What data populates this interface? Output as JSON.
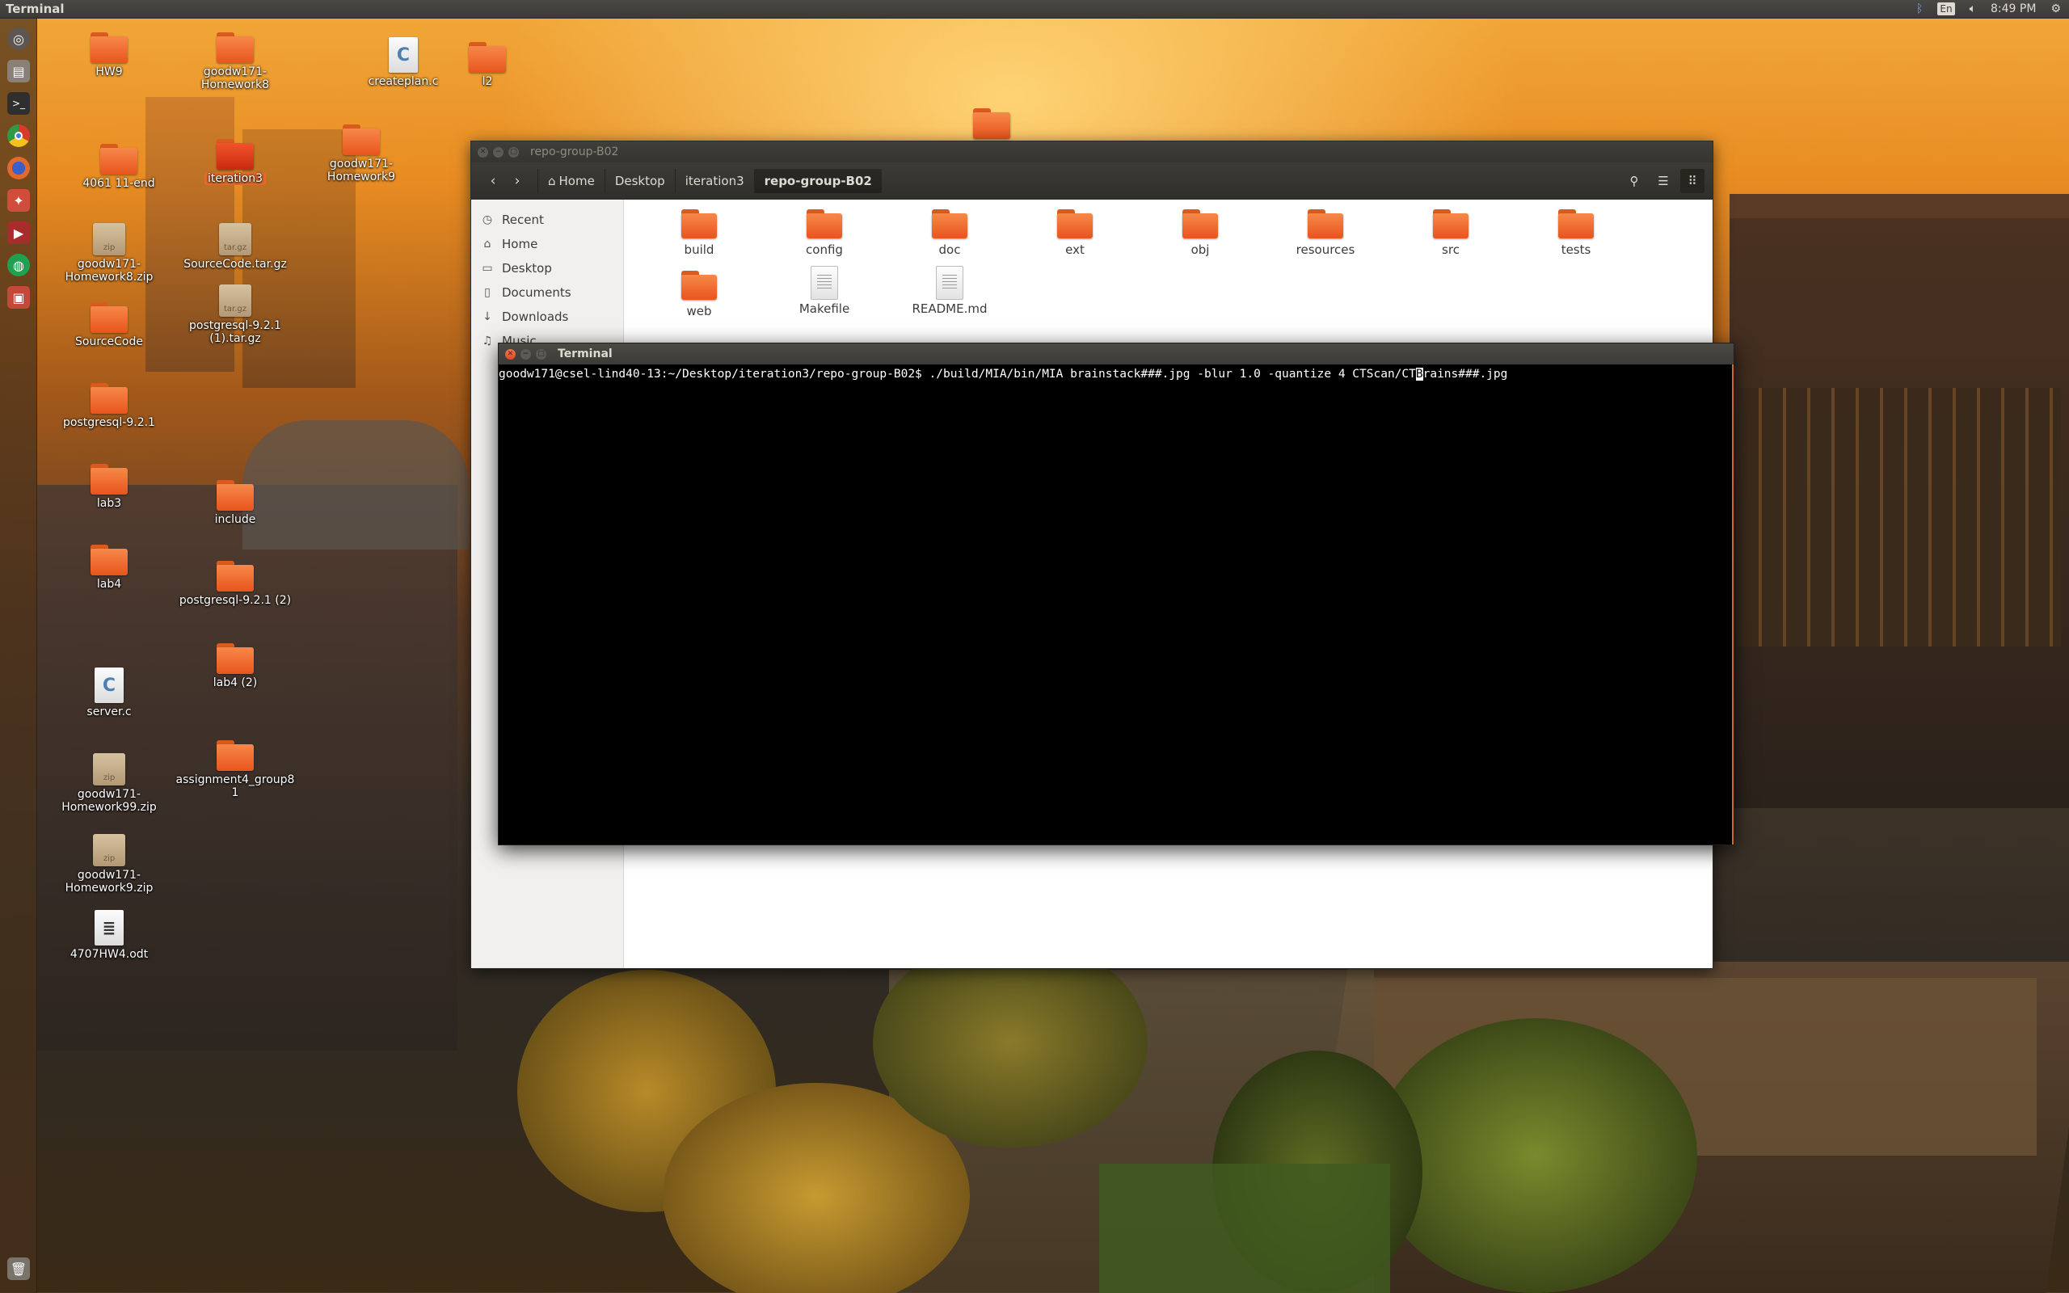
{
  "top_panel": {
    "app_title": "Terminal",
    "indicators": {
      "bluetooth": "bluetooth-icon",
      "language": "En",
      "volume": "volume-icon",
      "time": "8:49 PM",
      "settings": "gear-icon"
    }
  },
  "launcher": {
    "items": [
      {
        "name": "dash",
        "glyph": "◎",
        "color": "#5e5650"
      },
      {
        "name": "files",
        "glyph": "▤",
        "color": "#8a8078"
      },
      {
        "name": "terminal",
        "glyph": ">_",
        "color": "#2f2f2f"
      },
      {
        "name": "chrome",
        "glyph": "●",
        "color": "#2f8f3e"
      },
      {
        "name": "firefox",
        "glyph": "●",
        "color": "#e2692a"
      },
      {
        "name": "settings",
        "glyph": "✦",
        "color": "#d14d3b"
      },
      {
        "name": "app-red",
        "glyph": "▶",
        "color": "#a82c2c"
      },
      {
        "name": "app-green",
        "glyph": "●",
        "color": "#22a052"
      },
      {
        "name": "app-box",
        "glyph": "▣",
        "color": "#c34a3a"
      },
      {
        "name": "trash",
        "glyph": "🗑",
        "color": "#7a736a"
      }
    ]
  },
  "desktop_icons": [
    {
      "label": "HW9",
      "type": "folder"
    },
    {
      "label": "goodw171-Homework8",
      "type": "folder"
    },
    {
      "label": "createplan.c",
      "type": "c-source"
    },
    {
      "label": "l2",
      "type": "folder"
    },
    {
      "label": "4061 11-end",
      "type": "folder"
    },
    {
      "label": "iteration3",
      "type": "folder-selected"
    },
    {
      "label": "goodw171-Homework9",
      "type": "folder"
    },
    {
      "label": "goodw171-Homework8.zip",
      "type": "zip"
    },
    {
      "label": "SourceCode.tar.gz",
      "type": "tar.gz"
    },
    {
      "label": "SourceCode",
      "type": "folder"
    },
    {
      "label": "postgresql-9.2.1 (1).tar.gz",
      "type": "tar.gz"
    },
    {
      "label": "postgresql-9.2.1",
      "type": "folder"
    },
    {
      "label": "lab3",
      "type": "folder"
    },
    {
      "label": "include",
      "type": "folder"
    },
    {
      "label": "lab4",
      "type": "folder"
    },
    {
      "label": "postgresql-9.2.1 (2)",
      "type": "folder"
    },
    {
      "label": "lab4 (2)",
      "type": "folder"
    },
    {
      "label": "server.c",
      "type": "c-source"
    },
    {
      "label": "goodw171-Homework99.zip",
      "type": "zip"
    },
    {
      "label": "assignment4_group81",
      "type": "folder"
    },
    {
      "label": "goodw171-Homework9.zip",
      "type": "zip"
    },
    {
      "label": "4707HW4.odt",
      "type": "odt"
    },
    {
      "label": "",
      "type": "folder"
    }
  ],
  "archive_badges": {
    "zip": "zip",
    "targz": "tar.gz"
  },
  "file_manager": {
    "title": "repo-group-B02",
    "breadcrumbs": [
      "Home",
      "Desktop",
      "iteration3",
      "repo-group-B02"
    ],
    "sidebar": [
      "Recent",
      "Home",
      "Desktop",
      "Documents",
      "Downloads",
      "Music"
    ],
    "files": [
      {
        "name": "build",
        "type": "folder"
      },
      {
        "name": "config",
        "type": "folder"
      },
      {
        "name": "doc",
        "type": "folder"
      },
      {
        "name": "ext",
        "type": "folder"
      },
      {
        "name": "obj",
        "type": "folder"
      },
      {
        "name": "resources",
        "type": "folder"
      },
      {
        "name": "src",
        "type": "folder"
      },
      {
        "name": "tests",
        "type": "folder"
      },
      {
        "name": "web",
        "type": "folder"
      },
      {
        "name": "Makefile",
        "type": "text"
      },
      {
        "name": "README.md",
        "type": "text"
      }
    ]
  },
  "terminal": {
    "title": "Terminal",
    "prompt": "goodw171@csel-lind40-13:~/Desktop/iteration3/repo-group-B02$ ",
    "command_before_cursor": "./build/MIA/bin/MIA brainstack###.jpg -blur 1.0 -quantize 4 CTScan/CT",
    "cursor_char": "B",
    "command_after_cursor": "rains###.jpg"
  }
}
